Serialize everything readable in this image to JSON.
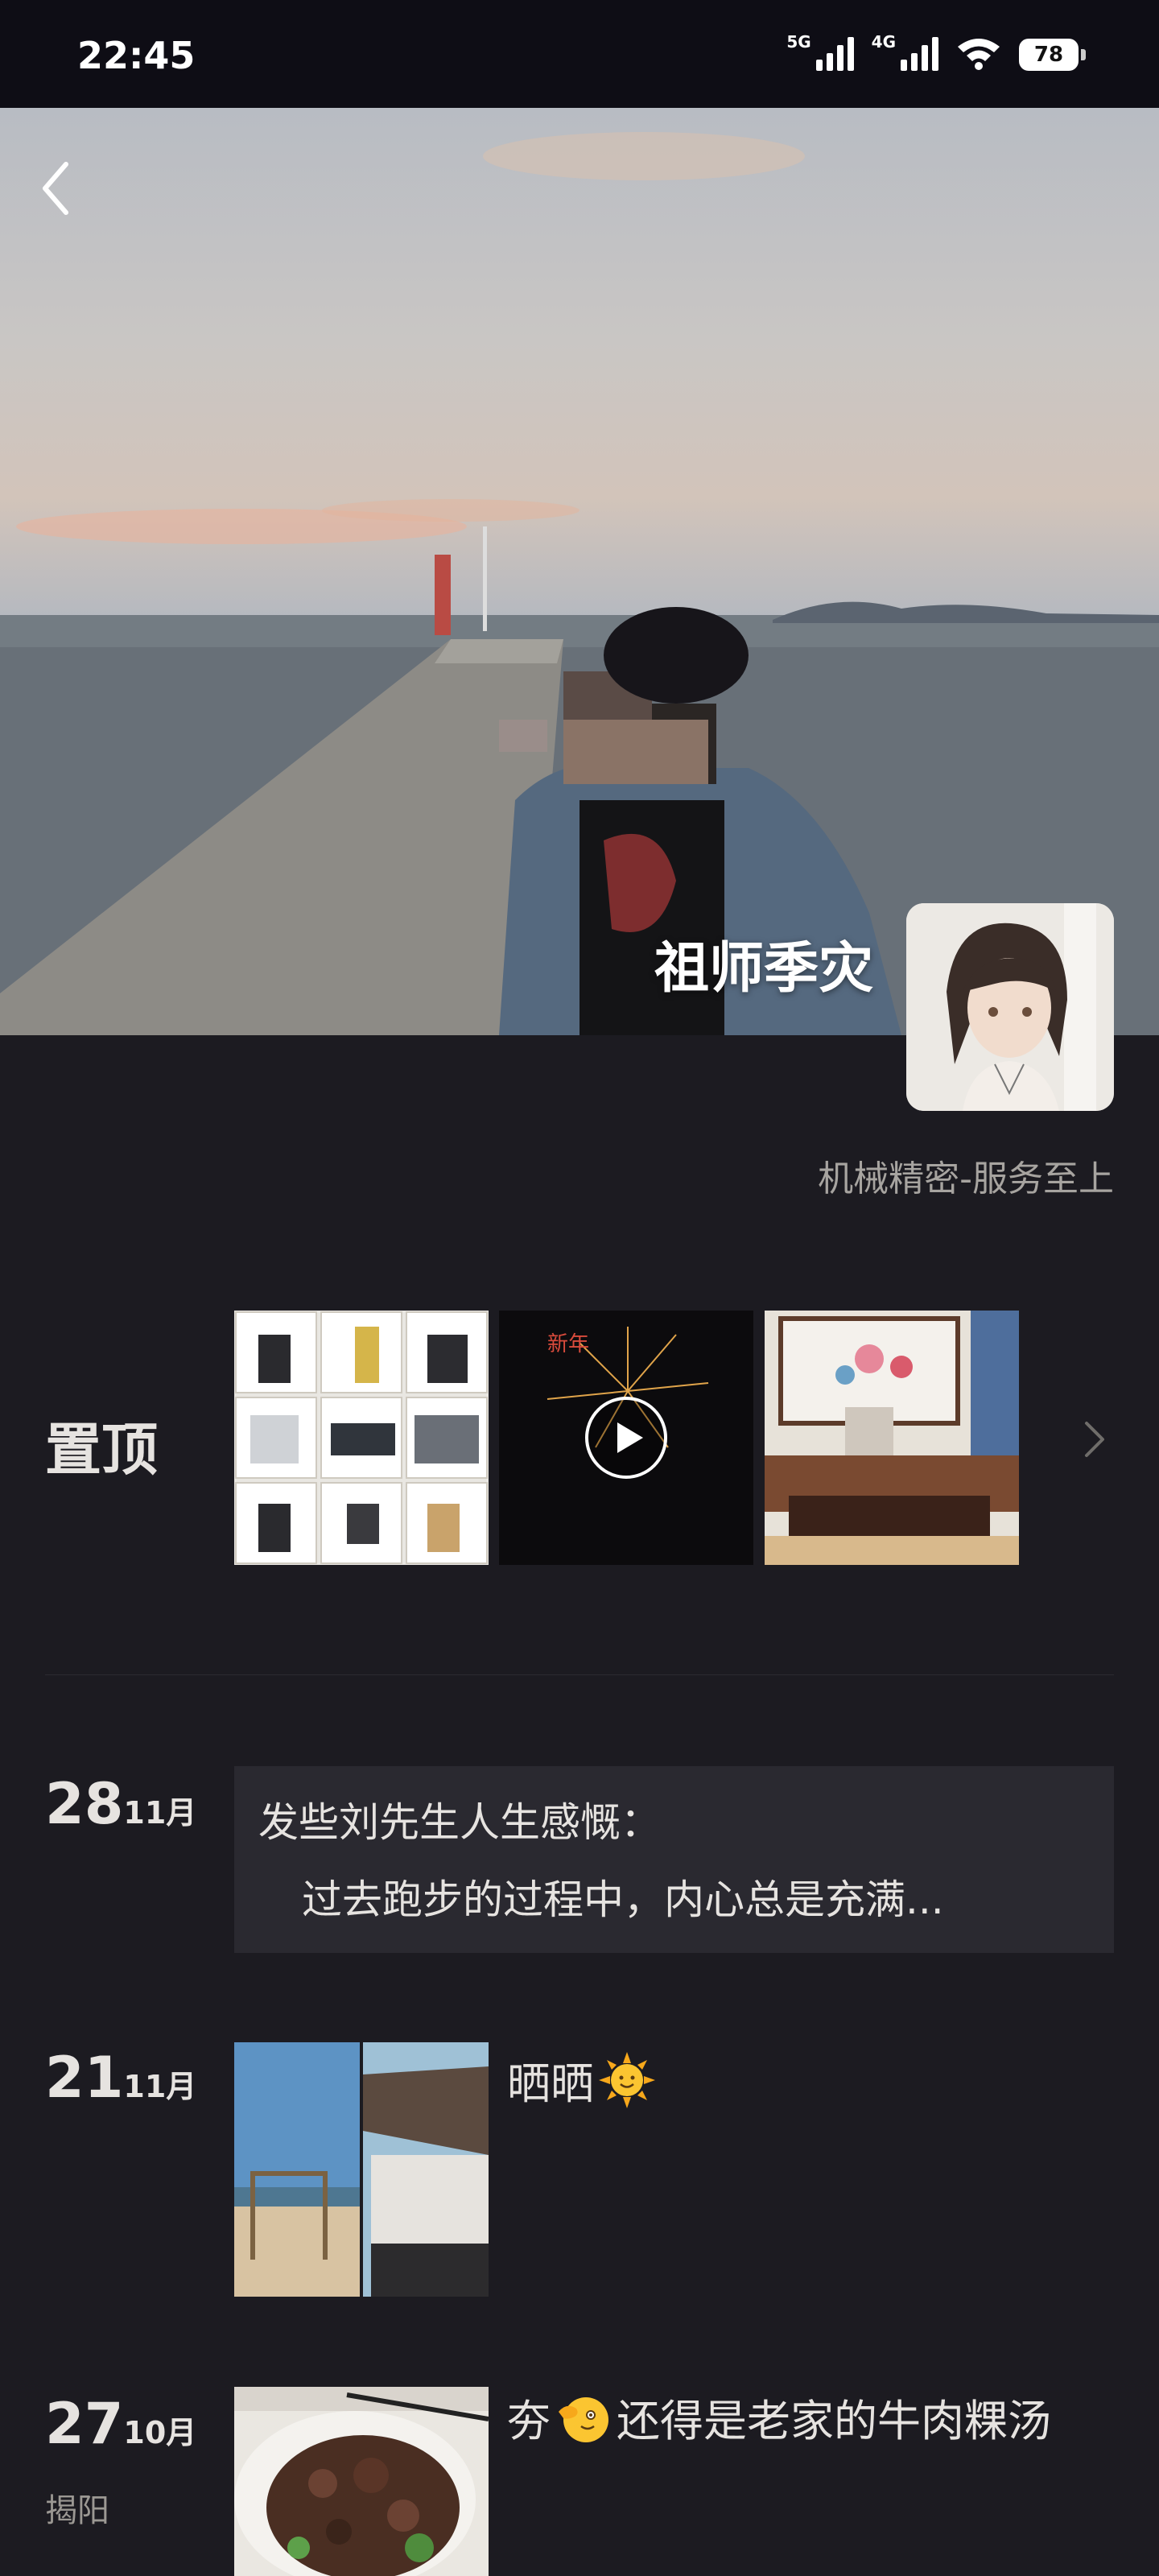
{
  "status_bar": {
    "time": "22:45",
    "net1": "5G",
    "net2": "4G",
    "battery": "78"
  },
  "profile": {
    "name": "祖师季灾",
    "signature": "机械精密-服务至上"
  },
  "pinned": {
    "label": "置顶"
  },
  "posts": [
    {
      "day": "28",
      "month": "11月",
      "line1": "发些刘先生人生感慨：",
      "line2": "过去跑步的过程中，内心总是充满..."
    },
    {
      "day": "21",
      "month": "11月",
      "caption": "晒晒",
      "emoji": "sun-emoji"
    },
    {
      "day": "27",
      "month": "10月",
      "location": "揭阳",
      "caption_prefix": "夯",
      "caption": "还得是老家的牛肉粿汤",
      "emoji": "pointing-emoji"
    }
  ]
}
